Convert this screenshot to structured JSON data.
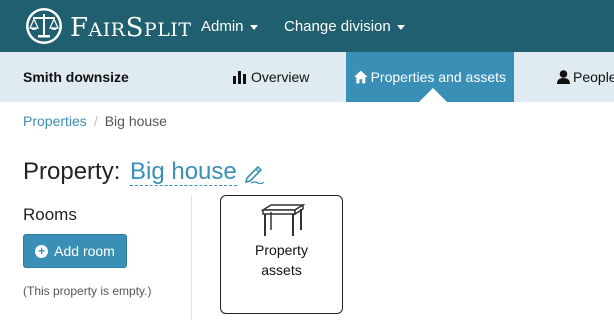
{
  "brand": {
    "text_first": "F",
    "text_rest": "AIR",
    "text_second": "S",
    "text_second_rest": "PLIT",
    "icon": "scales-logo-icon"
  },
  "topnav": {
    "admin_label": "Admin",
    "division_label": "Change division"
  },
  "subnav": {
    "project_name": "Smith downsize",
    "tabs": [
      {
        "label": "Overview",
        "icon": "bar-chart-icon",
        "active": false
      },
      {
        "label": "Properties and assets",
        "icon": "home-icon",
        "active": true
      },
      {
        "label": "People",
        "icon": "user-icon",
        "active": false
      }
    ]
  },
  "breadcrumb": {
    "parent": "Properties",
    "separator": "/",
    "current": "Big house"
  },
  "page": {
    "title_label": "Property:",
    "title_name": "Big house",
    "edit_icon": "pencil-edit-icon"
  },
  "rooms": {
    "heading": "Rooms",
    "add_button_label": "Add room",
    "add_icon": "plus-circle-icon",
    "empty_message": "(This property is empty.)"
  },
  "asset_card": {
    "label_line1": "Property",
    "label_line2": "assets",
    "icon": "table-icon"
  },
  "colors": {
    "topbar": "#1f5f6f",
    "subbar": "#dfeaf1",
    "accent": "#3a8fb7"
  }
}
